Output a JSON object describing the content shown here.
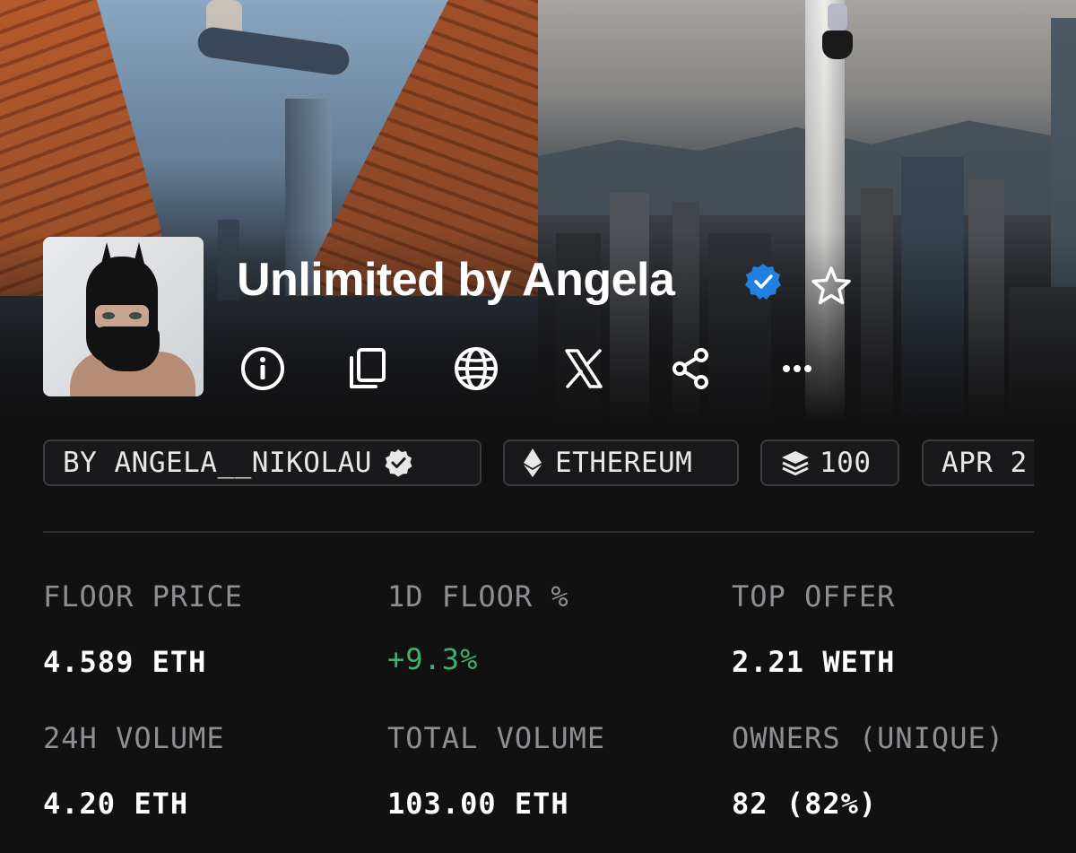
{
  "collection": {
    "title": "Unlimited by Angela",
    "verified": true
  },
  "actions": [
    {
      "name": "info-icon"
    },
    {
      "name": "copy-icon"
    },
    {
      "name": "globe-icon"
    },
    {
      "name": "x-logo-icon"
    },
    {
      "name": "share-icon"
    },
    {
      "name": "more-icon"
    }
  ],
  "tags": {
    "creator": "BY ANGELA__NIKOLAU",
    "chain": "ETHEREUM",
    "items": "100",
    "date": "APR 2"
  },
  "stats": {
    "floor_price": {
      "label": "FLOOR PRICE",
      "value": "4.589 ETH"
    },
    "floor_change": {
      "label": "1D FLOOR %",
      "value": "+9.3%"
    },
    "top_offer": {
      "label": "TOP OFFER",
      "value": "2.21 WETH"
    },
    "volume_24h": {
      "label": "24H VOLUME",
      "value": "4.20 ETH"
    },
    "total_volume": {
      "label": "TOTAL VOLUME",
      "value": "103.00 ETH"
    },
    "owners": {
      "label": "OWNERS (UNIQUE)",
      "value": "82 (82%)"
    }
  },
  "colors": {
    "background": "#111112",
    "verified_blue": "#2081e2",
    "positive": "#3fb06e",
    "muted_text": "#8e8f93"
  }
}
